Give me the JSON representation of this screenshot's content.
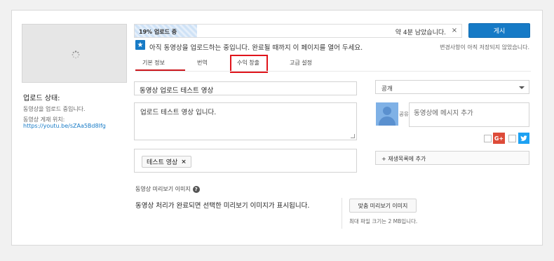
{
  "sidebar": {
    "upload_status_title": "업로드 상태:",
    "upload_status_message": "동영상을 업로드 중입니다.",
    "video_location_label": "동영상 게재 위치:",
    "video_url": "https://youtu.be/sZAa5Bd8Ifg"
  },
  "progress": {
    "percent_text": "19% 업로드 중",
    "percent": 19,
    "remaining_text": "약 4분 남았습니다.",
    "close_symbol": "×"
  },
  "header": {
    "publish_label": "게시",
    "notice_text": "아직 동영상을 업로드하는 중입니다. 완료될 때까지 이 페이지를 열어 두세요.",
    "unsaved_text": "변경사항이 아직 저장되지 않았습니다.",
    "star_icon": "★"
  },
  "tabs": [
    {
      "label": "기본 정보",
      "active": true
    },
    {
      "label": "번역",
      "active": false
    },
    {
      "label": "수익 창출",
      "active": false,
      "highlighted": true
    },
    {
      "label": "고급 설정",
      "active": false
    }
  ],
  "form": {
    "title_value": "동영상 업로드 테스트 영상",
    "description_value": "업로드 테스트 영상 입니다.",
    "tags": [
      {
        "label": "테스트 영상",
        "remove_symbol": "×"
      }
    ],
    "privacy_value": "공개",
    "share_label": "공유",
    "share_placeholder": "동영상에 메시지 추가",
    "google_plus_label": "G+",
    "playlist_label": "+ 재생목록에 추가"
  },
  "thumbnails": {
    "label": "동영상 미리보기 이미지",
    "help_symbol": "?",
    "message": "동영상 처리가 완료되면 선택한 미리보기 이미지가 표시됩니다.",
    "custom_button_label": "맞춤 미리보기 이미지",
    "max_size_text": "최대 파일 크기는 2 MB입니다."
  },
  "colors": {
    "accent": "#167ac6",
    "tab_active": "#cc181e",
    "highlight_box": "#e0141b",
    "google_plus": "#dd4b39",
    "twitter": "#1da1f2"
  }
}
